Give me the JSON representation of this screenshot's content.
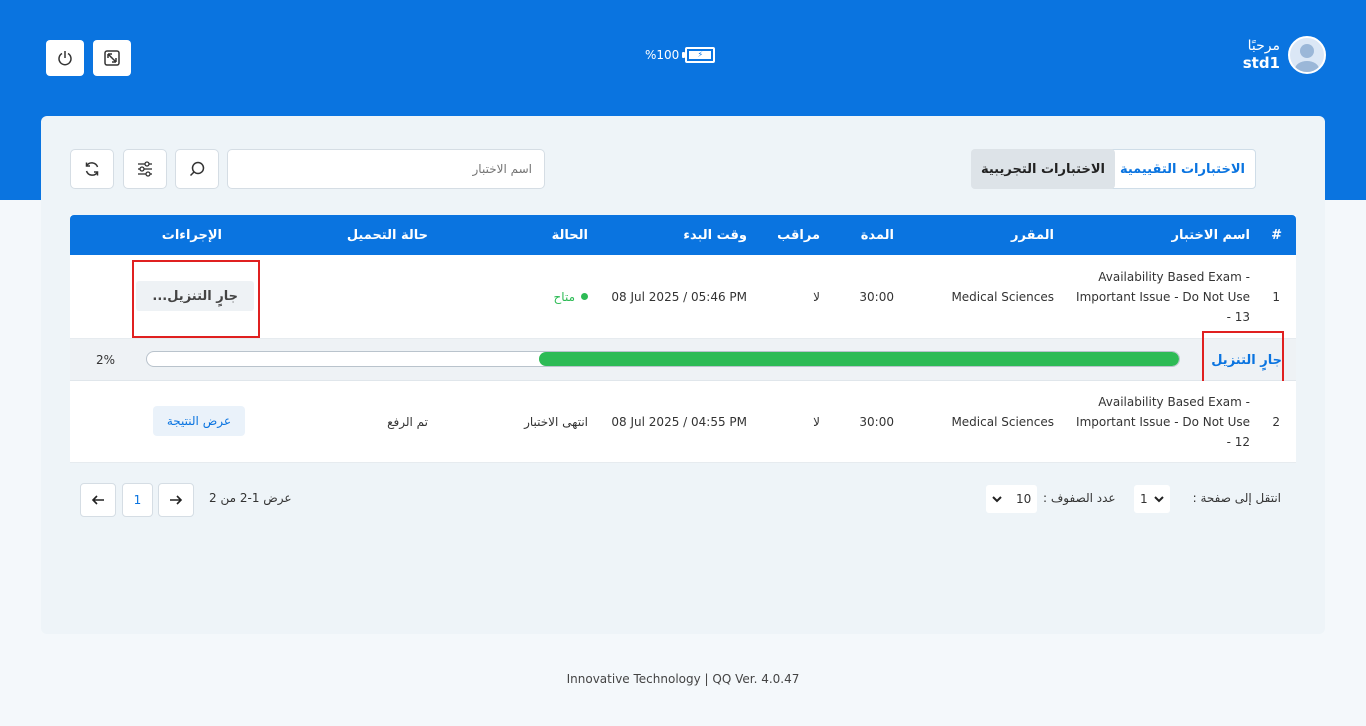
{
  "user": {
    "greeting": "مرحبًا",
    "username": "std1"
  },
  "battery": {
    "percent_label": "%100",
    "level": 1.0
  },
  "tabs": {
    "assessment": "الاختبارات التقييمية",
    "trial": "الاختبارات التجريبية"
  },
  "search": {
    "placeholder": "اسم الاختبار"
  },
  "table": {
    "headers": [
      "#",
      "اسم الاختبار",
      "المقرر",
      "المدة",
      "مراقب",
      "وقت البدء",
      "الحالة",
      "حالة التحميل",
      "الإجراءات"
    ],
    "rows": [
      {
        "num": "1",
        "name": "Availability Based Exam - Important Issue - Do Not Use - 13",
        "course": "Medical Sciences",
        "duration": "30:00",
        "proctored": "لا",
        "start": "08 Jul 2025 / 05:46 PM",
        "status": "متاح",
        "upload_status": "",
        "action": "جارٍ التنزيل..."
      },
      {
        "num": "2",
        "name": "Availability Based Exam - Important Issue - Do Not Use - 12",
        "course": "Medical Sciences",
        "duration": "30:00",
        "proctored": "لا",
        "start": "08 Jul 2025 / 04:55 PM",
        "status": "انتهى الاختبار",
        "upload_status": "تم الرفع",
        "action": "عرض النتيجة"
      }
    ],
    "download": {
      "label": "جارٍ التنزيل",
      "percent_label": "2%",
      "progress": 0.62
    }
  },
  "pagination": {
    "goto_label": "انتقل إلى صفحة :",
    "goto_value": "1",
    "rows_label": "عدد الصفوف :",
    "rows_value": "10",
    "summary": "عرض 1-2 من 2",
    "current_page": "1"
  },
  "footer": {
    "text": "Innovative Technology | QQ Ver. 4.0.47"
  }
}
